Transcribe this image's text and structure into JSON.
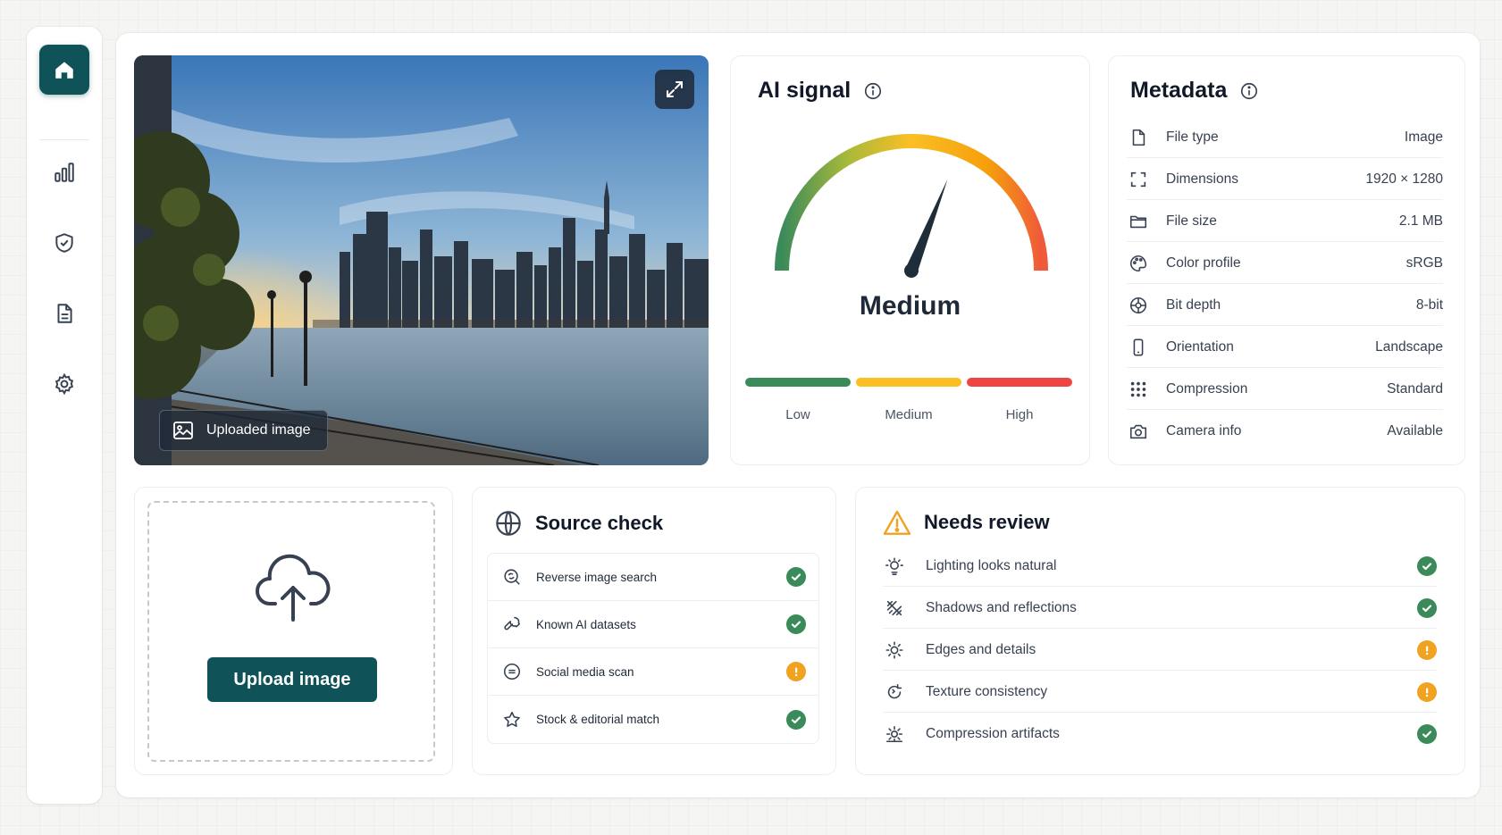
{
  "sidebar": {
    "items": [
      {
        "name": "home",
        "icon": "home-icon",
        "active": true
      },
      {
        "name": "analytics",
        "icon": "bar-chart-icon"
      },
      {
        "name": "security",
        "icon": "shield-check-icon"
      },
      {
        "name": "reports",
        "icon": "document-icon"
      },
      {
        "name": "settings",
        "icon": "gear-icon"
      }
    ]
  },
  "preview": {
    "caption": "Uploaded image",
    "expand_icon": "expand-icon"
  },
  "ai_signal": {
    "title": "AI signal",
    "level_label": "Medium",
    "level_fraction": 0.62,
    "scale": [
      {
        "label": "Low",
        "color": "#3b8a5a"
      },
      {
        "label": "Medium",
        "color": "#fbbf24"
      },
      {
        "label": "High",
        "color": "#ef4444"
      }
    ]
  },
  "metadata": {
    "title": "Metadata",
    "rows": [
      {
        "icon": "file-icon",
        "label": "File type",
        "value": "Image"
      },
      {
        "icon": "dimensions-icon",
        "label": "Dimensions",
        "value": "1920 × 1280"
      },
      {
        "icon": "folder-icon",
        "label": "File size",
        "value": "2.1 MB"
      },
      {
        "icon": "palette-icon",
        "label": "Color profile",
        "value": "sRGB"
      },
      {
        "icon": "aperture-icon",
        "label": "Bit depth",
        "value": "8-bit"
      },
      {
        "icon": "phone-icon",
        "label": "Orientation",
        "value": "Landscape"
      },
      {
        "icon": "grid-icon",
        "label": "Compression",
        "value": "Standard"
      },
      {
        "icon": "camera-icon",
        "label": "Camera info",
        "value": "Available"
      }
    ]
  },
  "upload": {
    "button_label": "Upload image"
  },
  "source_check": {
    "title": "Source check",
    "rows": [
      {
        "icon": "reverse-search-icon",
        "label": "Reverse image search",
        "status": "ok"
      },
      {
        "icon": "wrench-icon",
        "label": "Known AI datasets",
        "status": "ok"
      },
      {
        "icon": "chat-icon",
        "label": "Social media scan",
        "status": "warn"
      },
      {
        "icon": "star-icon",
        "label": "Stock & editorial match",
        "status": "ok"
      }
    ]
  },
  "needs_review": {
    "title": "Needs review",
    "rows": [
      {
        "icon": "light-icon",
        "label": "Lighting looks natural",
        "status": "ok"
      },
      {
        "icon": "shadow-icon",
        "label": "Shadows and reflections",
        "status": "ok"
      },
      {
        "icon": "sun-icon",
        "label": "Edges and details",
        "status": "warn"
      },
      {
        "icon": "texture-icon",
        "label": "Texture consistency",
        "status": "warn"
      },
      {
        "icon": "artifact-icon",
        "label": "Compression artifacts",
        "status": "ok"
      }
    ]
  },
  "colors": {
    "brand": "#0f5258",
    "ok": "#3b8a5a",
    "warn": "#f0a320"
  }
}
